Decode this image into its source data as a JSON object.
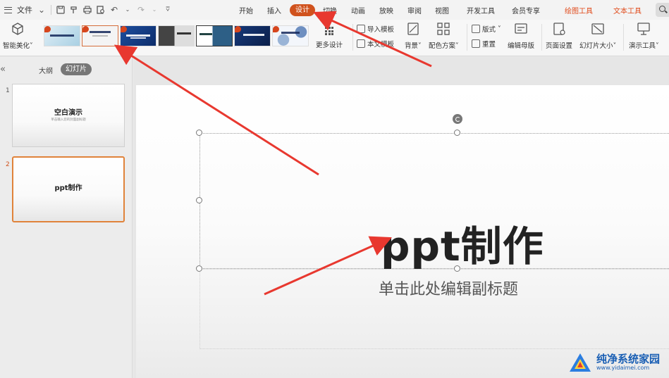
{
  "menubar": {
    "file_label": "文件",
    "tabs": [
      "开始",
      "插入",
      "设计",
      "切换",
      "动画",
      "放映",
      "审阅",
      "视图",
      "开发工具",
      "会员专享",
      "绘图工具",
      "文本工具"
    ],
    "active_tab": "设计"
  },
  "ribbon": {
    "smart_beautify": "智能美化",
    "more_design": "更多设计",
    "import_template": "导入模板",
    "this_template": "本文模板",
    "background": "背景",
    "color_scheme": "配色方案",
    "layout": "版式",
    "reset": "重置",
    "edit_master": "编辑母版",
    "page_setup": "页面设置",
    "slide_size": "幻灯片大小",
    "presentation_tools": "演示工具"
  },
  "panel": {
    "tab_outline": "大纲",
    "tab_slides": "幻灯片",
    "slides": [
      {
        "number": "1",
        "title": "空白演示",
        "subtitle": "单击输入您的封面副标题"
      },
      {
        "number": "2",
        "title": "ppt制作",
        "subtitle": ""
      }
    ],
    "current_slide": 2
  },
  "slide": {
    "title": "ppt制作",
    "subtitle_placeholder": "单击此处编辑副标题"
  },
  "watermark": {
    "name": "纯净系统家园",
    "url": "www.yidaimei.com"
  },
  "colors": {
    "accent": "#d0521d",
    "annotation_arrow": "#e8382f",
    "selection": "#e0833a"
  }
}
